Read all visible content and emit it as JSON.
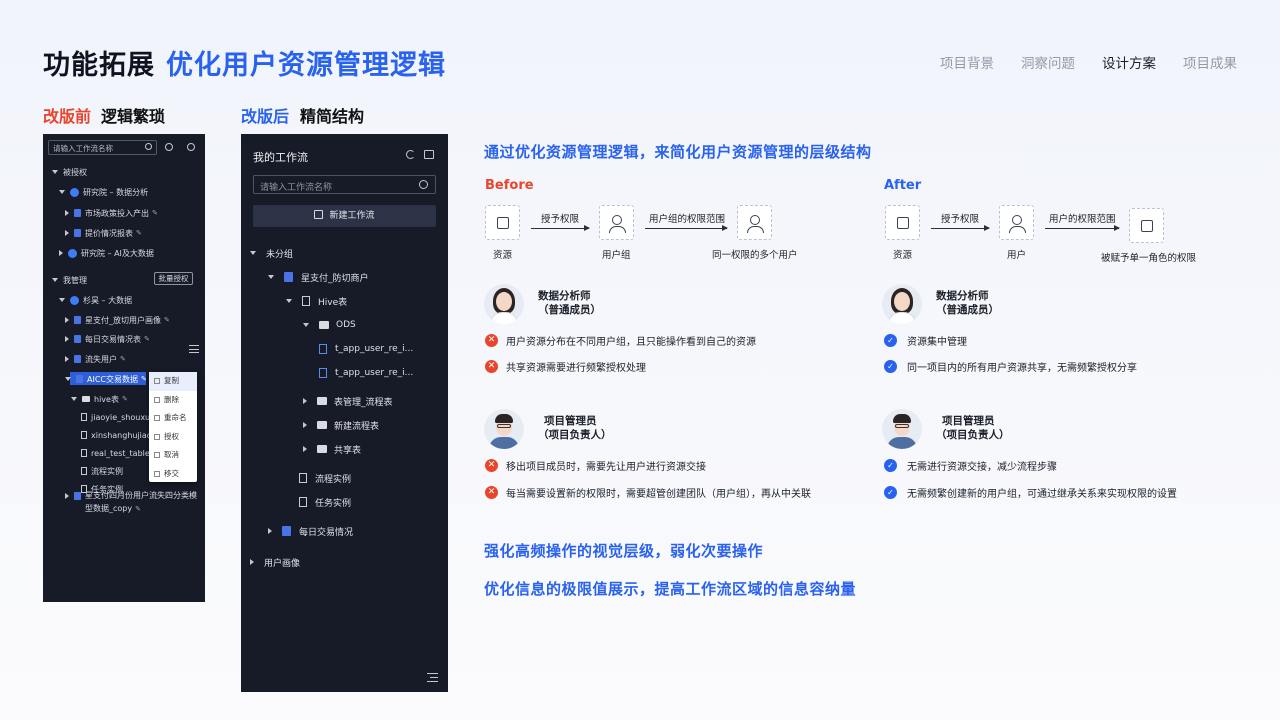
{
  "header": {
    "title": "功能拓展",
    "subtitle": "优化用户资源管理逻辑",
    "nav": [
      "项目背景",
      "洞察问题",
      "设计方案",
      "项目成果"
    ],
    "nav_active_index": 2
  },
  "before_section": {
    "tag": "改版前",
    "desc": "逻辑繁琐"
  },
  "after_section": {
    "tag": "改版后",
    "desc": "精简结构"
  },
  "old_panel": {
    "search_placeholder": "请输入工作流名称",
    "group_authorized": "被授权",
    "authorized_items": [
      "研究院 – 数据分析",
      "市场政策投入产出",
      "提价情况报表",
      "研究院 – AI及大数据"
    ],
    "group_mine": "我管理",
    "batch_button": "批量授权",
    "mine_items": [
      "杉昊 – 大数据",
      "星支付_放切用户画像",
      "每日交易情况表",
      "流失用户",
      "AICC交易数据",
      "hive表",
      "jiaoyie_shouxufei",
      "xinshanghujiaoyi",
      "real_test_table_",
      "流程实例",
      "任务实例",
      "星支付四月份用户流失四分类模",
      "型数据_copy"
    ],
    "context_menu": [
      "复制",
      "删除",
      "重命名",
      "授权",
      "取消",
      "移交"
    ]
  },
  "new_panel": {
    "title": "我的工作流",
    "search_placeholder": "请输入工作流名称",
    "new_button": "新建工作流",
    "tree": [
      "未分组",
      "星支付_防切商户",
      "Hive表",
      "ODS",
      "t_app_user_re_i...",
      "t_app_user_re_i...",
      "表管理_流程表",
      "新建流程表",
      "共享表",
      "流程实例",
      "任务实例",
      "每日交易情况",
      "用户画像"
    ]
  },
  "right": {
    "headline": "通过优化资源管理逻辑，来简化用户资源管理的层级结构",
    "before": {
      "label": "Before",
      "flow": {
        "n1": "资源",
        "a1": "授予权限",
        "n2": "用户组",
        "a2": "用户组的权限范围",
        "n3": "同一权限的多个用户"
      },
      "role1": {
        "name": "数据分析师",
        "desc": "（普通成员）"
      },
      "role1_points": [
        "用户资源分布在不同用户组，且只能操作看到自己的资源",
        "共享资源需要进行频繁授权处理"
      ],
      "role2": {
        "name": "项目管理员",
        "desc": "（项目负责人）"
      },
      "role2_points": [
        "移出项目成员时，需要先让用户进行资源交接",
        "每当需要设置新的权限时，需要超管创建团队（用户组），再从中关联"
      ]
    },
    "after": {
      "label": "After",
      "flow": {
        "n1": "资源",
        "a1": "授予权限",
        "n2": "用户",
        "a2": "用户的权限范围",
        "n3": "被赋予单一角色的权限"
      },
      "role1": {
        "name": "数据分析师",
        "desc": "（普通成员）"
      },
      "role1_points": [
        "资源集中管理",
        "同一项目内的所有用户资源共享，无需频繁授权分享"
      ],
      "role2": {
        "name": "项目管理员",
        "desc": "（项目负责人）"
      },
      "role2_points": [
        "无需进行资源交接，减少流程步骤",
        "无需频繁创建新的用户组，可通过继承关系来实现权限的设置"
      ]
    },
    "summary1": "强化高频操作的视觉层级，弱化次要操作",
    "summary2": "优化信息的极限值展示，提高工作流区域的信息容纳量"
  },
  "colors": {
    "accent": "#2a62f0",
    "danger": "#e8452c",
    "panel_bg": "#171b27"
  }
}
